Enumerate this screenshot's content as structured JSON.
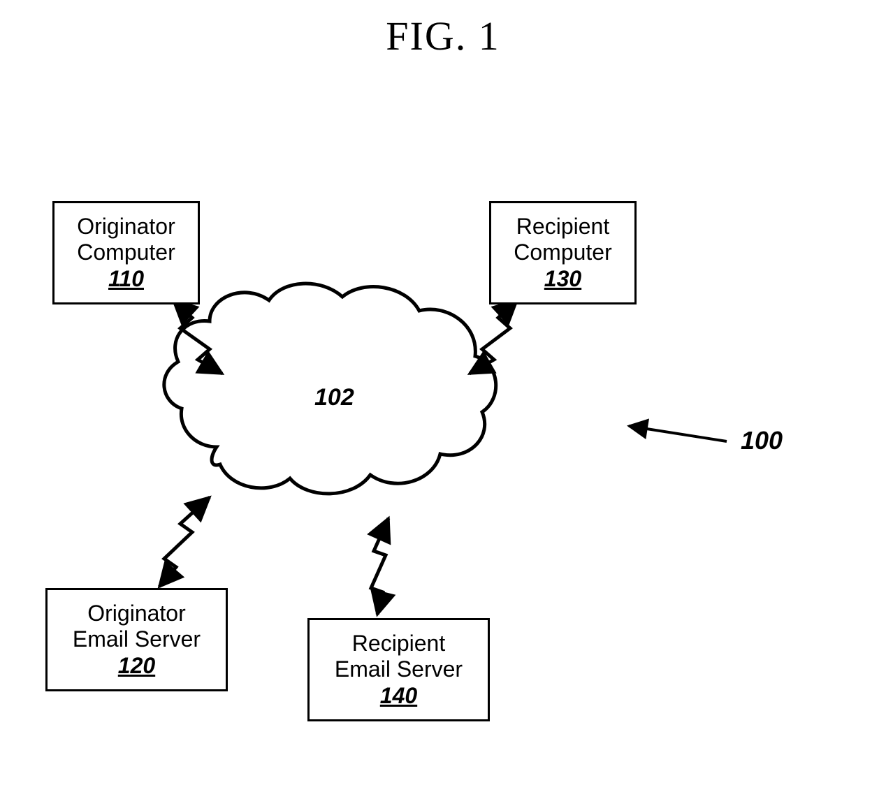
{
  "title": "FIG. 1",
  "nodes": {
    "originator_computer": {
      "label_line1": "Originator",
      "label_line2": "Computer",
      "ref": "110"
    },
    "recipient_computer": {
      "label_line1": "Recipient",
      "label_line2": "Computer",
      "ref": "130"
    },
    "originator_server": {
      "label_line1": "Originator",
      "label_line2": "Email Server",
      "ref": "120"
    },
    "recipient_server": {
      "label_line1": "Recipient",
      "label_line2": "Email Server",
      "ref": "140"
    },
    "cloud": {
      "ref": "102"
    }
  },
  "system_ref": "100"
}
